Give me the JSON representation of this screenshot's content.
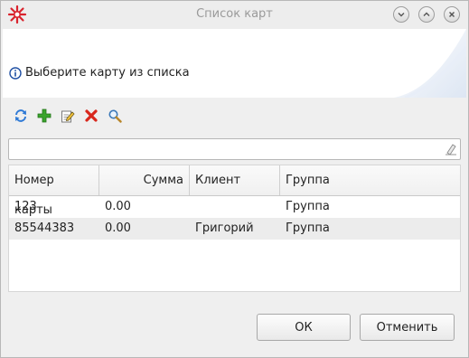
{
  "window": {
    "title": "Список карт"
  },
  "header": {
    "info_text": "Выберите карту из списка"
  },
  "toolbar": {
    "icons": [
      "refresh-icon",
      "add-icon",
      "edit-icon",
      "delete-icon",
      "search-icon"
    ]
  },
  "search": {
    "value": "",
    "placeholder": ""
  },
  "table": {
    "columns": [
      "Номер карты",
      "Сумма",
      "Клиент",
      "Группа"
    ],
    "rows": [
      {
        "card": "123",
        "sum": "0.00",
        "client": "",
        "group": "Группа"
      },
      {
        "card": "85544383",
        "sum": "0.00",
        "client": "Григорий",
        "group": "Группа"
      }
    ]
  },
  "buttons": {
    "ok": "ОК",
    "cancel": "Отменить"
  },
  "colors": {
    "app_icon": "#d9232d",
    "info_icon": "#1f4fa3",
    "add": "#3aa32c",
    "delete": "#d8271c",
    "refresh": "#2f7ad6"
  }
}
